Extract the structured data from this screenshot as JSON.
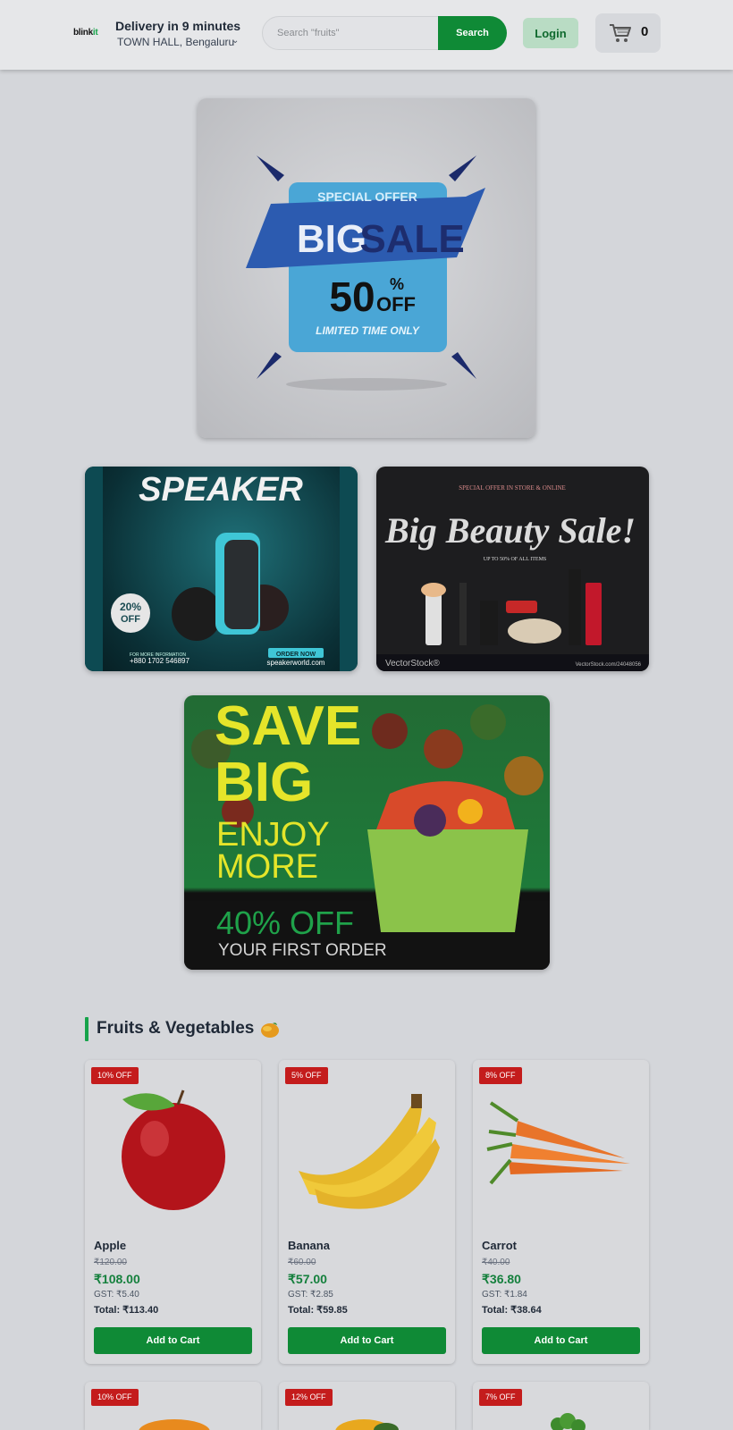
{
  "header": {
    "logo": {
      "main": "blink",
      "accent": "it"
    },
    "delivery_title": "Delivery in 9 minutes",
    "location": "TOWN HALL, Bengaluru",
    "search_placeholder": "Search \"fruits\"",
    "search_button": "Search",
    "login_button": "Login",
    "cart_count": "0"
  },
  "banners": {
    "big_sale": {
      "top": "SPECIAL OFFER",
      "main1": "BIG",
      "main2": "SALE",
      "percent": "50",
      "pct_sign": "%",
      "off": "OFF",
      "bottom": "LIMITED TIME ONLY"
    },
    "speaker": {
      "title": "SPEAKER",
      "badge_pct": "20%",
      "badge_off": "OFF",
      "info_label": "FOR MORE INFORMATION",
      "phone": "+880 1702 546897",
      "cta": "ORDER NOW",
      "website": "speakerworld.com"
    },
    "beauty": {
      "top": "SPECIAL OFFER IN STORE & ONLINE",
      "title": "Big Beauty Sale!",
      "sub": "UP TO 50% OF ALL ITEMS",
      "watermark": "VectorStock®",
      "credit": "VectorStock.com/24048056"
    },
    "save_big": {
      "line1": "SAVE",
      "line2": "BIG",
      "line3": "ENJOY",
      "line4": "MORE",
      "offer": "40% OFF",
      "offer_sub": "YOUR FIRST ORDER"
    }
  },
  "section": {
    "title": "Fruits & Vegetables"
  },
  "products": [
    {
      "badge": "10% OFF",
      "name": "Apple",
      "mrp": "₹120.00",
      "price": "₹108.00",
      "gst": "GST: ₹5.40",
      "total": "Total: ₹113.40",
      "button": "Add to Cart"
    },
    {
      "badge": "5% OFF",
      "name": "Banana",
      "mrp": "₹60.00",
      "price": "₹57.00",
      "gst": "GST: ₹2.85",
      "total": "Total: ₹59.85",
      "button": "Add to Cart"
    },
    {
      "badge": "8% OFF",
      "name": "Carrot",
      "mrp": "₹40.00",
      "price": "₹36.80",
      "gst": "GST: ₹1.84",
      "total": "Total: ₹38.64",
      "button": "Add to Cart"
    }
  ],
  "products_row2_badges": [
    "10% OFF",
    "12% OFF",
    "7% OFF"
  ],
  "colors": {
    "brand_green": "#0f8a36",
    "badge_red": "#c41c1c",
    "price_green": "#15803d"
  }
}
